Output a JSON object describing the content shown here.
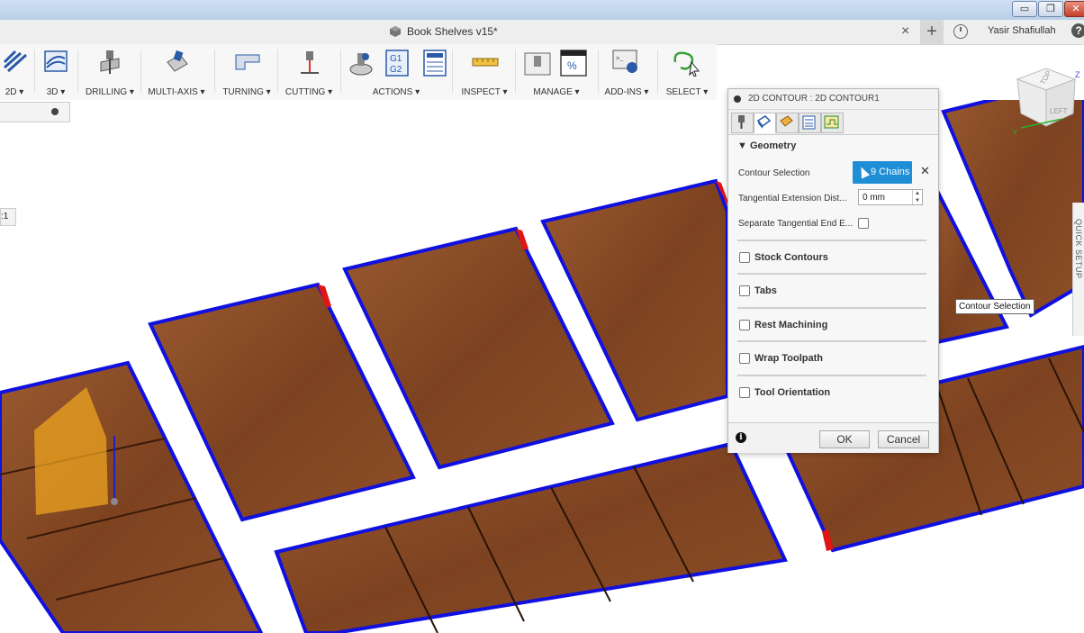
{
  "window": {
    "document_title": "Book Shelves v15*",
    "user_name": "Yasir Shafiullah",
    "help_glyph": "?"
  },
  "toolbar": {
    "groups": [
      {
        "label": "2D ▾",
        "icon": "2d-milling-icon"
      },
      {
        "label": "3D ▾",
        "icon": "3d-milling-icon"
      },
      {
        "label": "DRILLING ▾",
        "icon": "drill-icon"
      },
      {
        "label": "MULTI-AXIS ▾",
        "icon": "multi-axis-icon"
      },
      {
        "label": "TURNING ▾",
        "icon": "turning-icon"
      },
      {
        "label": "CUTTING ▾",
        "icon": "cutting-icon"
      },
      {
        "label": "ACTIONS ▾",
        "icon": "actions-icon"
      },
      {
        "label": "INSPECT ▾",
        "icon": "measure-icon"
      },
      {
        "label": "MANAGE ▾",
        "icon": "manage-icon"
      },
      {
        "label": "ADD-INS ▾",
        "icon": "add-ins-icon"
      },
      {
        "label": "SELECT ▾",
        "icon": "select-icon"
      }
    ],
    "actions_icon_text": [
      "G1",
      "G2"
    ],
    "manage_icon_text": "%"
  },
  "scale_tag": ":1",
  "dialog": {
    "title": "2D CONTOUR : 2D CONTOUR1",
    "geometry_group": "Geometry",
    "contour_selection_label": "Contour Selection",
    "contour_selection_value": "9 Chains",
    "tangential_label": "Tangential Extension Dist...",
    "tangential_value": "0 mm",
    "separate_label": "Separate Tangential End E...",
    "sections": [
      "Stock Contours",
      "Tabs",
      "Rest Machining",
      "Wrap Toolpath",
      "Tool Orientation"
    ],
    "ok": "OK",
    "cancel": "Cancel",
    "info_glyph": "i"
  },
  "tooltip": "Contour Selection",
  "quick_setup": "QUICK SETUP",
  "viewcube": {
    "top": "TOP",
    "left": "LEFT"
  },
  "colors": {
    "accent": "#1e8fd6",
    "wood": "#8a4a24",
    "contour_blue": "#1010e0",
    "selection_red": "#e01515"
  }
}
